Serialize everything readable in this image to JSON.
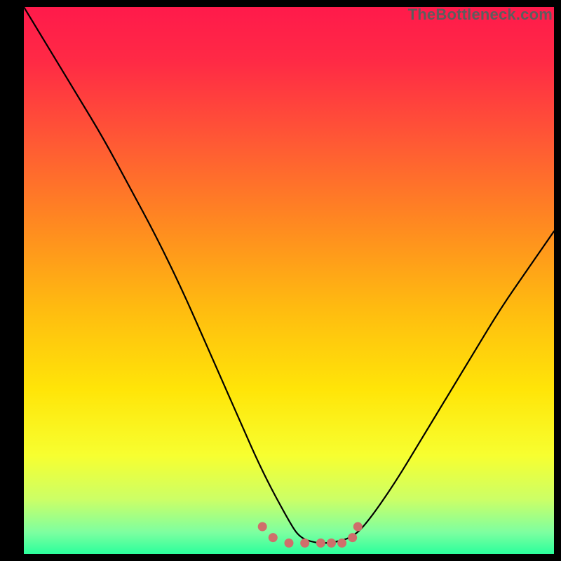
{
  "watermark": "TheBottleneck.com",
  "chart_data": {
    "type": "line",
    "title": "",
    "xlabel": "",
    "ylabel": "",
    "xlim": [
      0,
      100
    ],
    "ylim": [
      0,
      100
    ],
    "grid": false,
    "legend": false,
    "gradient_stops": [
      {
        "offset": 0.0,
        "color": "#ff1a4b"
      },
      {
        "offset": 0.1,
        "color": "#ff2a45"
      },
      {
        "offset": 0.25,
        "color": "#ff5a34"
      },
      {
        "offset": 0.4,
        "color": "#ff8a20"
      },
      {
        "offset": 0.55,
        "color": "#ffbb10"
      },
      {
        "offset": 0.7,
        "color": "#ffe508"
      },
      {
        "offset": 0.82,
        "color": "#f7ff30"
      },
      {
        "offset": 0.9,
        "color": "#ccff66"
      },
      {
        "offset": 0.96,
        "color": "#7effa0"
      },
      {
        "offset": 1.0,
        "color": "#2bff9c"
      }
    ],
    "series": [
      {
        "name": "bottleneck-curve",
        "color": "#000000",
        "x": [
          0,
          5,
          10,
          15,
          20,
          25,
          30,
          35,
          40,
          45,
          50,
          52,
          55,
          58,
          62,
          65,
          70,
          75,
          80,
          85,
          90,
          95,
          100
        ],
        "values": [
          100,
          92,
          84,
          76,
          67,
          58,
          48,
          37,
          26,
          15,
          6,
          3,
          2,
          2,
          3,
          6,
          13,
          21,
          29,
          37,
          45,
          52,
          59
        ]
      },
      {
        "name": "dot-markers",
        "type": "scatter",
        "color": "#cf6f6b",
        "x": [
          45,
          47,
          50,
          53,
          56,
          58,
          60,
          62,
          63
        ],
        "values": [
          5,
          3,
          2,
          2,
          2,
          2,
          2,
          3,
          5
        ]
      }
    ]
  }
}
